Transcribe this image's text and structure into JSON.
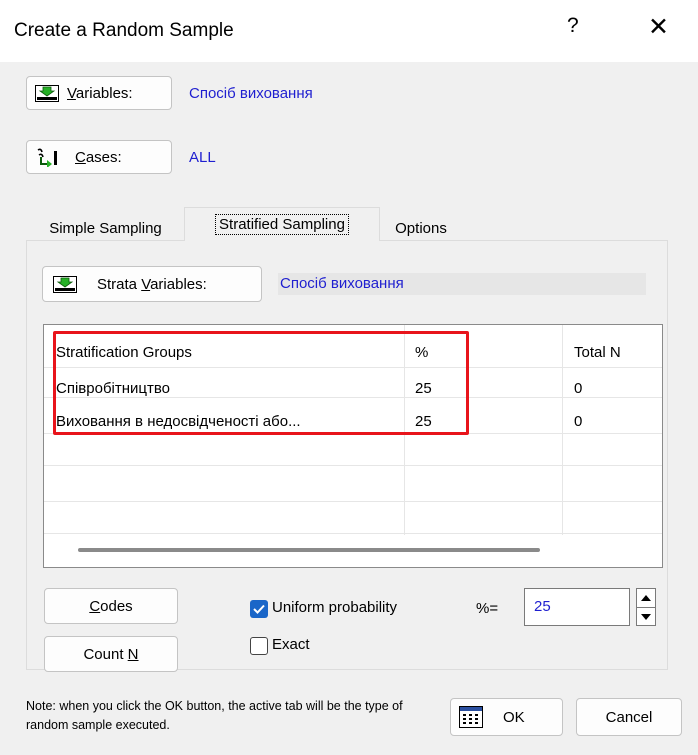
{
  "window": {
    "title": "Create a Random Sample",
    "help_glyph": "?",
    "close_glyph": "✕"
  },
  "variables": {
    "button_prefix": "V",
    "button_rest": "ariables:",
    "value": "Спосіб виховання"
  },
  "cases": {
    "button_prefix": "C",
    "button_rest": "ases:",
    "value": "ALL"
  },
  "tabs": [
    {
      "label": "Simple Sampling"
    },
    {
      "label": "Stratified Sampling"
    },
    {
      "label": "Options"
    }
  ],
  "strata": {
    "button_a": "Strata ",
    "button_u": "V",
    "button_b": "ariables:",
    "value": "Спосіб виховання"
  },
  "table": {
    "headers": [
      "Stratification Groups",
      "%",
      "Total N"
    ],
    "rows": [
      [
        "Співробітництво",
        "25",
        "0"
      ],
      [
        "Виховання в недосвідченості або...",
        "25",
        "0"
      ]
    ]
  },
  "codes_button": {
    "prefix": "C",
    "rest": "odes"
  },
  "count_button": {
    "a": "Count ",
    "u": "N"
  },
  "uniform": {
    "label": "Uniform probability",
    "checked": true
  },
  "exact": {
    "label": "Exact",
    "checked": false
  },
  "percent": {
    "label": "%=",
    "value": "25"
  },
  "note": "Note: when you click the OK button, the active tab will be the type of random sample executed.",
  "ok_label": "OK",
  "cancel_label": "Cancel",
  "colors": {
    "accent": "#1a66c8",
    "highlight": "#e8141b",
    "link": "#1f1fd0"
  }
}
